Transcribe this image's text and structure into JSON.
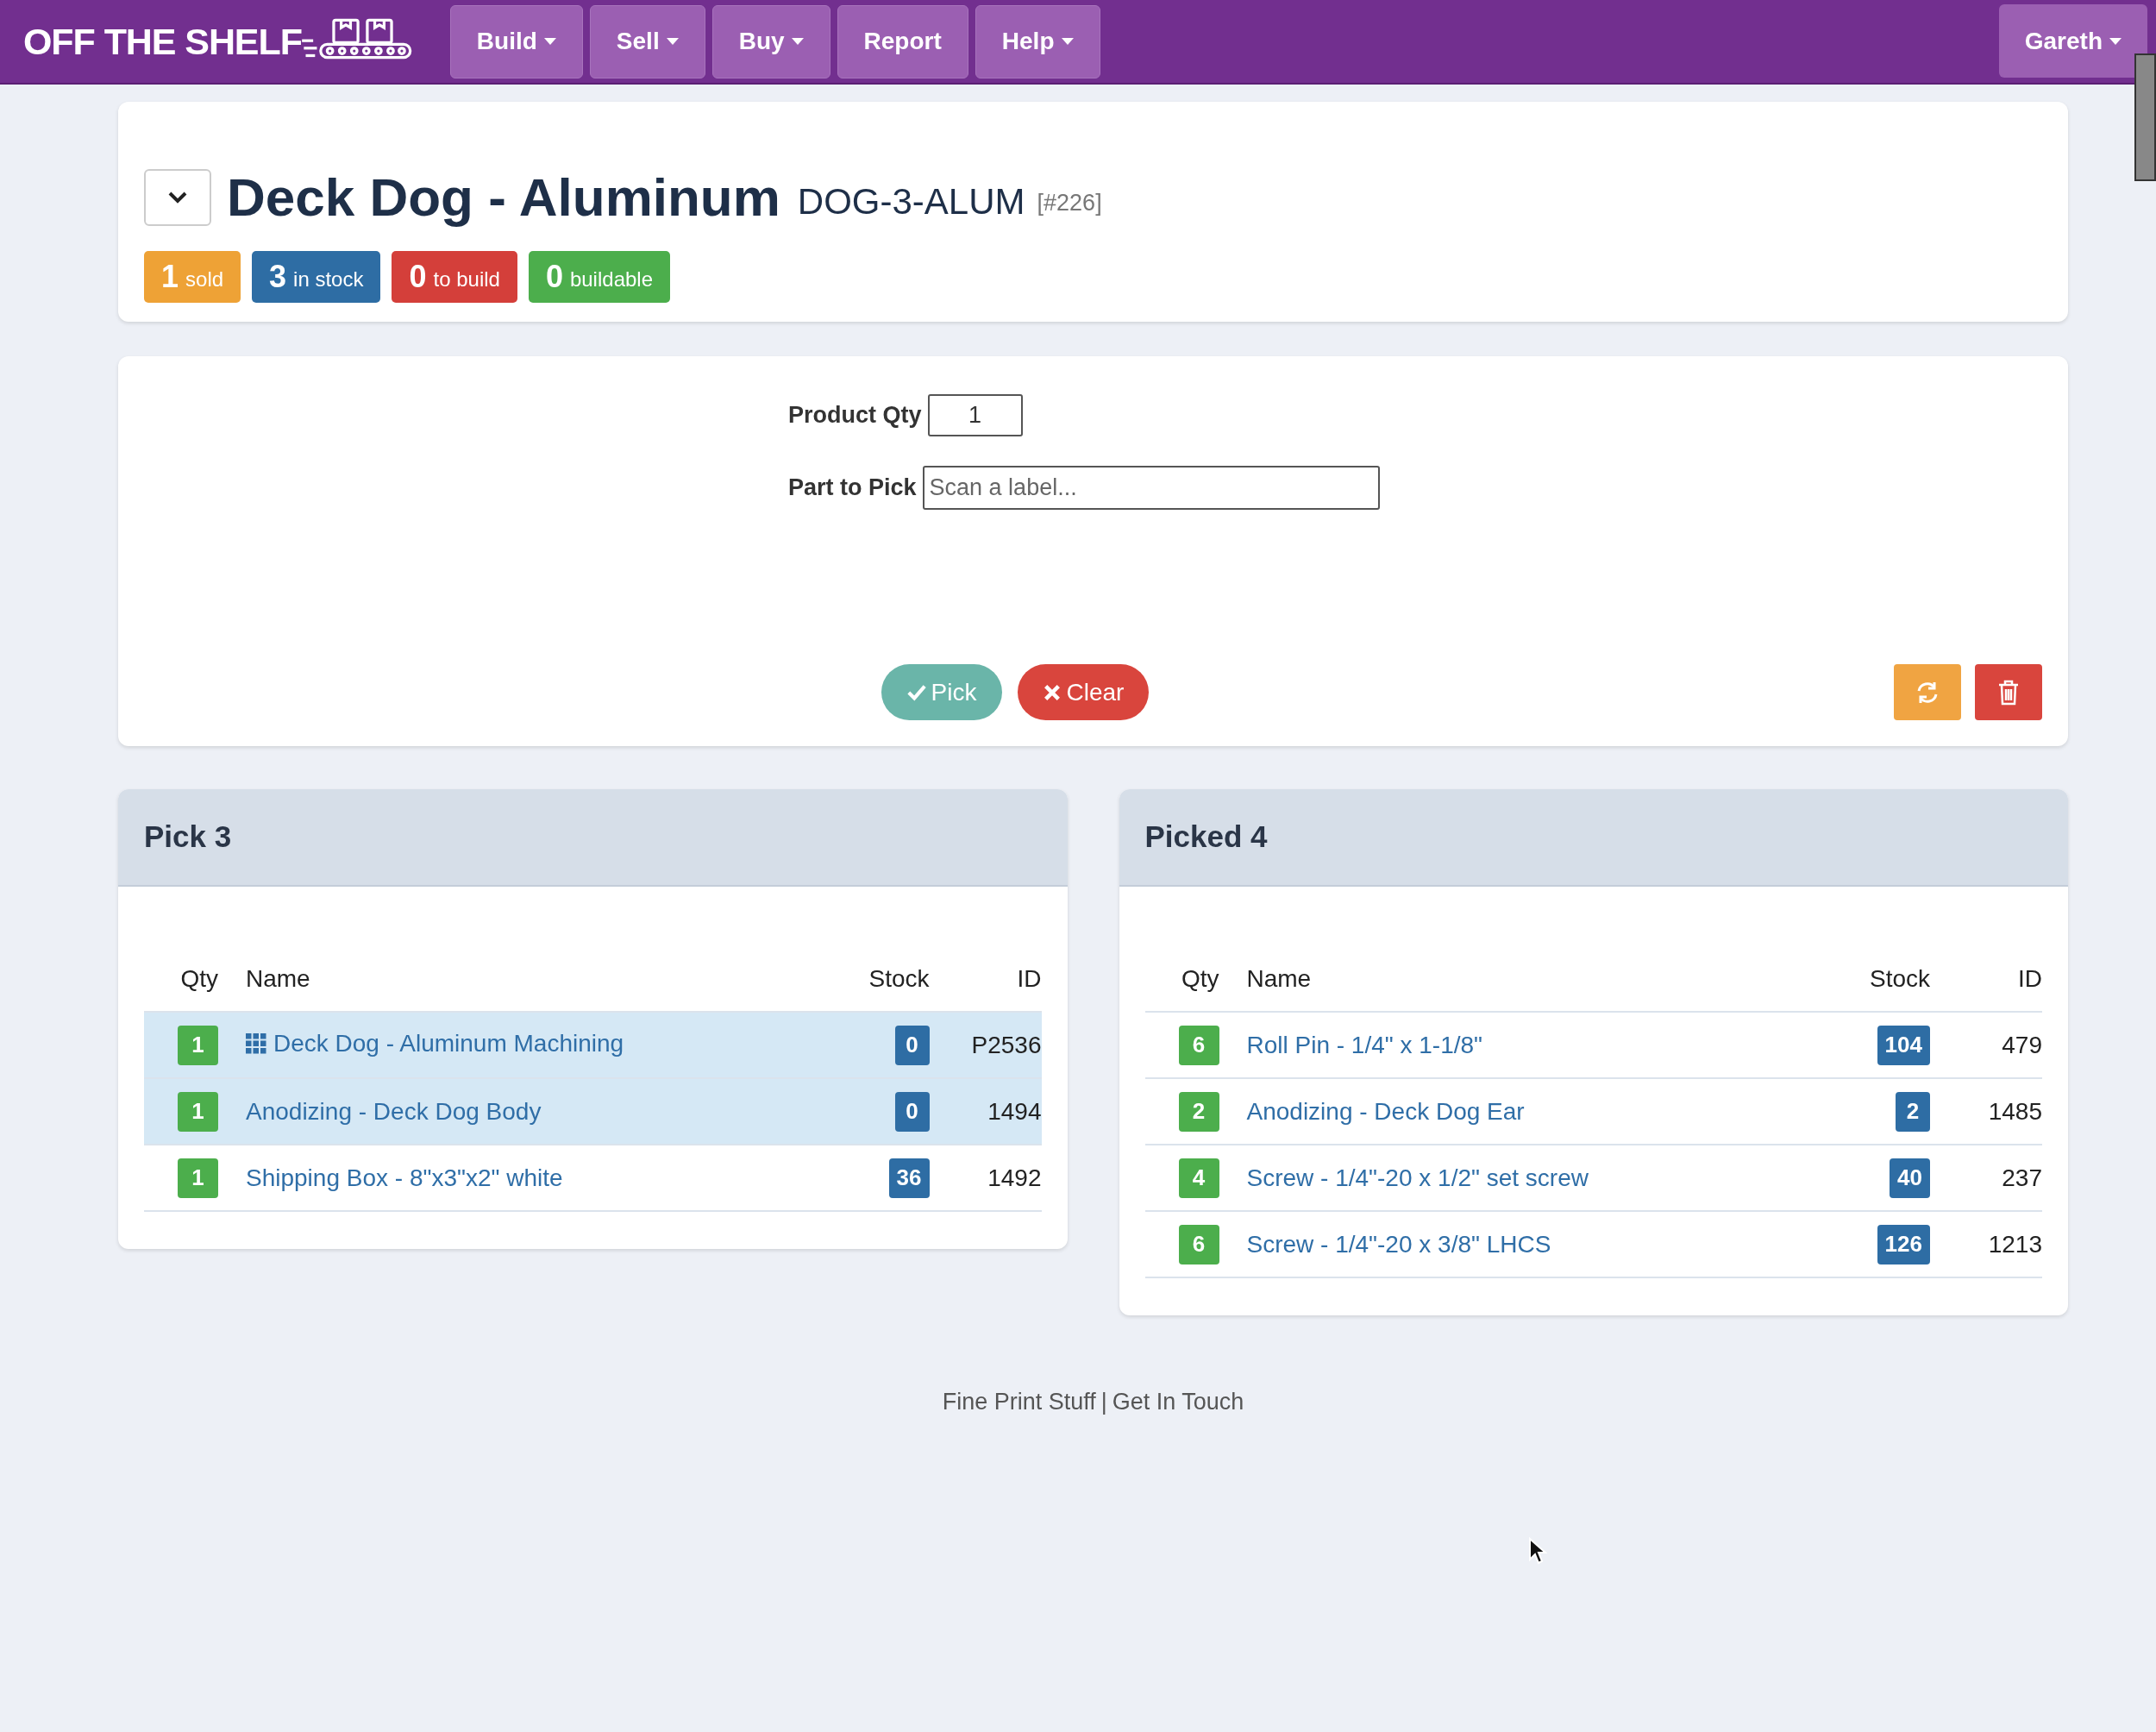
{
  "navbar": {
    "logo": "OFF THE SHELF",
    "menus": [
      {
        "label": "Build",
        "dropdown": true
      },
      {
        "label": "Sell",
        "dropdown": true
      },
      {
        "label": "Buy",
        "dropdown": true
      },
      {
        "label": "Report",
        "dropdown": false
      },
      {
        "label": "Help",
        "dropdown": true
      }
    ],
    "user": {
      "label": "Gareth",
      "dropdown": true
    }
  },
  "product": {
    "title": "Deck Dog - Aluminum",
    "sku": "DOG-3-ALUM",
    "id": "[#226]",
    "badges": [
      {
        "count": "1",
        "label": "sold",
        "color": "#eea236"
      },
      {
        "count": "3",
        "label": "in stock",
        "color": "#2e6da4"
      },
      {
        "count": "0",
        "label": "to build",
        "color": "#d43f3a"
      },
      {
        "count": "0",
        "label": "buildable",
        "color": "#4cae4c"
      }
    ]
  },
  "form": {
    "product_qty": {
      "label": "Product Qty",
      "value": "1"
    },
    "part_to_pick": {
      "label": "Part to Pick",
      "placeholder": "Scan a label..."
    },
    "buttons": [
      {
        "kind": "pick",
        "label": "Pick"
      },
      {
        "kind": "clear",
        "label": "Clear"
      }
    ]
  },
  "tables": [
    {
      "title": "Pick 3",
      "columns": [
        "Qty",
        "Name",
        "Stock",
        "ID"
      ],
      "rows": [
        {
          "qty": "1",
          "name": "Deck Dog - Aluminum Machining",
          "kind": "assembly",
          "stock": "0",
          "id": "P2536",
          "highlighted": true
        },
        {
          "qty": "1",
          "name": "Anodizing - Deck Dog Body",
          "kind": "part",
          "stock": "0",
          "id": "1494",
          "highlighted": true
        },
        {
          "qty": "1",
          "name": "Shipping Box - 8\"x3\"x2\" white",
          "kind": "part",
          "stock": "36",
          "id": "1492",
          "highlighted": false
        }
      ]
    },
    {
      "title": "Picked 4",
      "columns": [
        "Qty",
        "Name",
        "Stock",
        "ID"
      ],
      "rows": [
        {
          "qty": "6",
          "name": "Roll Pin - 1/4\" x 1-1/8\"",
          "kind": "part",
          "stock": "104",
          "id": "479",
          "highlighted": false
        },
        {
          "qty": "2",
          "name": "Anodizing - Deck Dog Ear",
          "kind": "part",
          "stock": "2",
          "id": "1485",
          "highlighted": false
        },
        {
          "qty": "4",
          "name": "Screw - 1/4\"-20 x 1/2\" set screw",
          "kind": "part",
          "stock": "40",
          "id": "237",
          "highlighted": false
        },
        {
          "qty": "6",
          "name": "Screw - 1/4\"-20 x 3/8\" LHCS",
          "kind": "part",
          "stock": "126",
          "id": "1213",
          "highlighted": false
        }
      ]
    }
  ],
  "footer": {
    "links": [
      "Fine Print Stuff",
      "Get In Touch"
    ],
    "separator": "|"
  }
}
